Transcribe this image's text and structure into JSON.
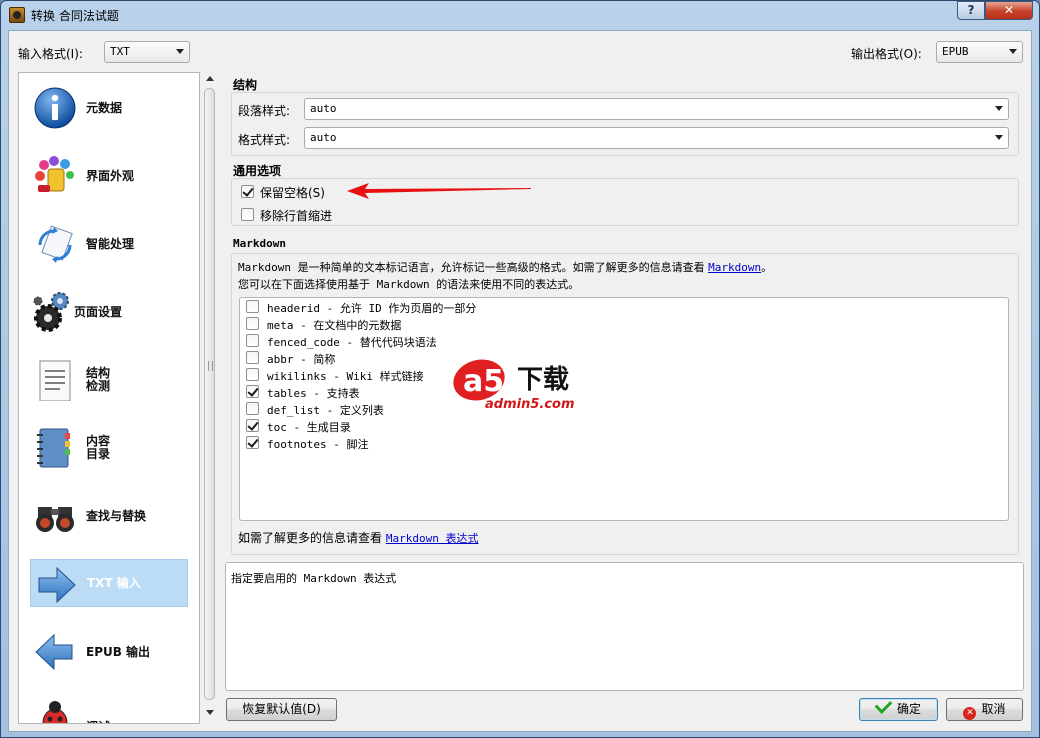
{
  "window": {
    "title": "转换 合同法试题",
    "help_glyph": "?",
    "close_glyph": "✕"
  },
  "toolbar": {
    "input_format_label": "输入格式(I):",
    "input_format_value": "TXT",
    "output_format_label": "输出格式(O):",
    "output_format_value": "EPUB"
  },
  "sidebar": {
    "items": [
      {
        "label_line1": "元数据",
        "label_line2": "",
        "icon": "info-icon"
      },
      {
        "label_line1": "界面外观",
        "label_line2": "",
        "icon": "paint-icon"
      },
      {
        "label_line1": "智能处理",
        "label_line2": "",
        "icon": "wand-icon"
      },
      {
        "label_line1": "页面设置",
        "label_line2": "",
        "icon": "gears-icon"
      },
      {
        "label_line1": "结构",
        "label_line2": "检测",
        "icon": "document-icon"
      },
      {
        "label_line1": "内容",
        "label_line2": "目录",
        "icon": "notebook-icon"
      },
      {
        "label_line1": "查找与替换",
        "label_line2": "",
        "icon": "binoculars-icon"
      },
      {
        "label_line1": "TXT 输入",
        "label_line2": "",
        "icon": "arrow-right-icon",
        "selected": true
      },
      {
        "label_line1": "EPUB 输出",
        "label_line2": "",
        "icon": "arrow-left-icon"
      },
      {
        "label_line1": "调试",
        "label_line2": "",
        "icon": "bug-icon"
      }
    ]
  },
  "structure": {
    "title": "结构",
    "paragraph_style_label": "段落样式:",
    "paragraph_style_value": "auto",
    "format_style_label": "格式样式:",
    "format_style_value": "auto"
  },
  "common": {
    "title": "通用选项",
    "preserve_spaces": {
      "label": "保留空格(S)",
      "checked": true
    },
    "remove_indent": {
      "label": "移除行首缩进",
      "checked": false
    }
  },
  "markdown": {
    "title": "Markdown",
    "desc_line1_prefix": "Markdown 是一种简单的文本标记语言，允许标记一些高级的格式。如需了解更多的信息请查看",
    "desc_line1_link": "Markdown",
    "desc_line1_suffix": "。",
    "desc_line2": "您可以在下面选择使用基于 Markdown 的语法来使用不同的表达式。",
    "extensions": [
      {
        "label": "headerid - 允许 ID 作为页眉的一部分",
        "checked": false
      },
      {
        "label": "meta - 在文档中的元数据",
        "checked": false
      },
      {
        "label": "fenced_code - 替代代码块语法",
        "checked": false
      },
      {
        "label": "abbr - 简称",
        "checked": false
      },
      {
        "label": "wikilinks - Wiki 样式链接",
        "checked": false
      },
      {
        "label": "tables - 支持表",
        "checked": true
      },
      {
        "label": "def_list - 定义列表",
        "checked": false
      },
      {
        "label": "toc - 生成目录",
        "checked": true
      },
      {
        "label": "footnotes - 脚注",
        "checked": true
      }
    ],
    "more_prefix": "如需了解更多的信息请查看",
    "more_link": "Markdown 表达式"
  },
  "help_text": "指定要启用的 Markdown 表达式",
  "watermark": {
    "text1": "a5",
    "text2": "下载",
    "url": "admin5.com"
  },
  "buttons": {
    "restore_defaults": "恢复默认值(D)",
    "ok": "确定",
    "cancel": "取消",
    "cancel_glyph": "✕"
  },
  "colors": {
    "accent": "#bcdcf6",
    "link": "#0000d0",
    "annotation_arrow": "#e81010"
  }
}
